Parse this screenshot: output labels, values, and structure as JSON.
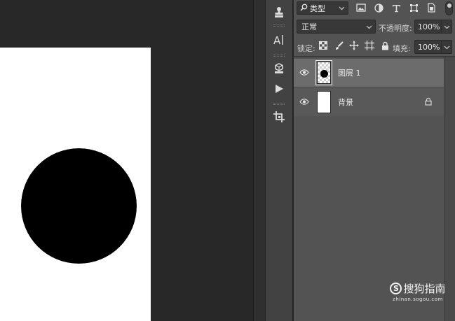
{
  "layers_panel": {
    "filter": {
      "label": "类型"
    },
    "blend_mode": {
      "value": "正常"
    },
    "opacity": {
      "label": "不透明度:",
      "value": "100%"
    },
    "lock": {
      "label": "锁定:"
    },
    "fill": {
      "label": "填充:",
      "value": "100%"
    },
    "layers": [
      {
        "name": "图层 1",
        "selected": true,
        "visible": true
      },
      {
        "name": "背景",
        "selected": false,
        "visible": true,
        "locked": true
      }
    ]
  },
  "toolbar": {
    "tools": [
      "clone-stamp-icon",
      "character-icon",
      "3d-cube-icon",
      "play-icon",
      "crop-icon"
    ]
  },
  "watermark": {
    "brand": "搜狗指南",
    "url": "zhinan.sogou.com"
  },
  "colors": {
    "panel_bg": "#535353",
    "selected_layer": "#6c6c6c",
    "canvas_bg": "#282828",
    "document": "#ffffff",
    "shape": "#000000"
  }
}
